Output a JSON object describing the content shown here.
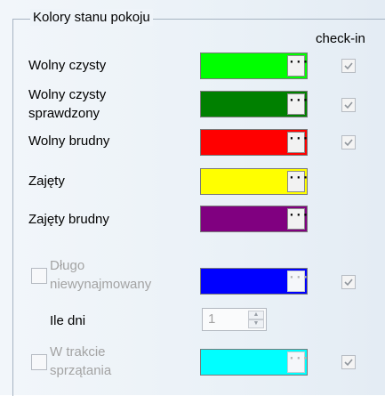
{
  "group": {
    "title": "Kolory stanu pokoju"
  },
  "header": {
    "checkin": "check-in"
  },
  "rows": [
    {
      "label": "Wolny czysty",
      "color": "#00ff00",
      "checked": true
    },
    {
      "label_line1": "Wolny czysty",
      "label_line2": "sprawdzony",
      "color": "#008000",
      "checked": true
    },
    {
      "label": "Wolny brudny",
      "color": "#ff0000",
      "checked": true
    },
    {
      "label": "Zajęty",
      "color": "#ffff00"
    },
    {
      "label": "Zajęty brudny",
      "color": "#800080"
    }
  ],
  "long_unrented": {
    "label_line1": "Długo",
    "label_line2": "niewynajmowany",
    "color": "#0000ff",
    "enabled": false,
    "checked": true,
    "days_label": "Ile dni",
    "days_value": "1"
  },
  "cleaning": {
    "label_line1": "W trakcie",
    "label_line2": "sprzątania",
    "color": "#00ffff",
    "enabled": false,
    "checked": true
  },
  "ellipsis": "···"
}
